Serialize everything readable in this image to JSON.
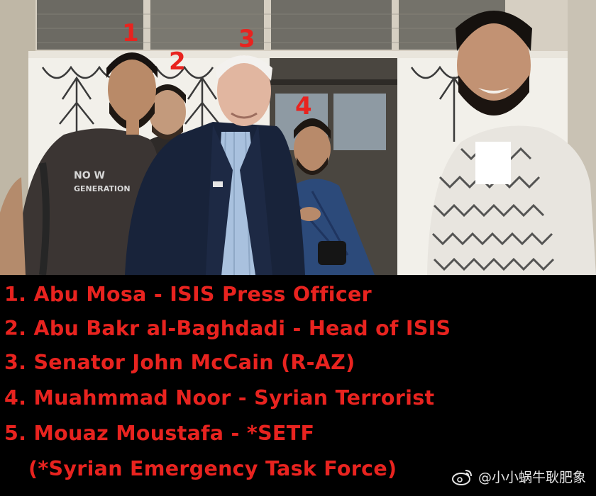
{
  "photo": {
    "markers": [
      "1",
      "2",
      "3",
      "4"
    ]
  },
  "caption": {
    "lines": [
      "1. Abu Mosa - ISIS Press Officer",
      "2. Abu Bakr al-Baghdadi - Head of ISIS",
      "3. Senator John McCain (R-AZ)",
      "4. Muahmmad Noor - Syrian Terrorist",
      "5. Mouaz Moustafa - *SETF",
      "(*Syrian Emergency Task Force)"
    ],
    "text_color": "#e8231f"
  },
  "watermark": {
    "icon": "weibo-icon",
    "text": "@小小蜗牛耿肥象"
  }
}
